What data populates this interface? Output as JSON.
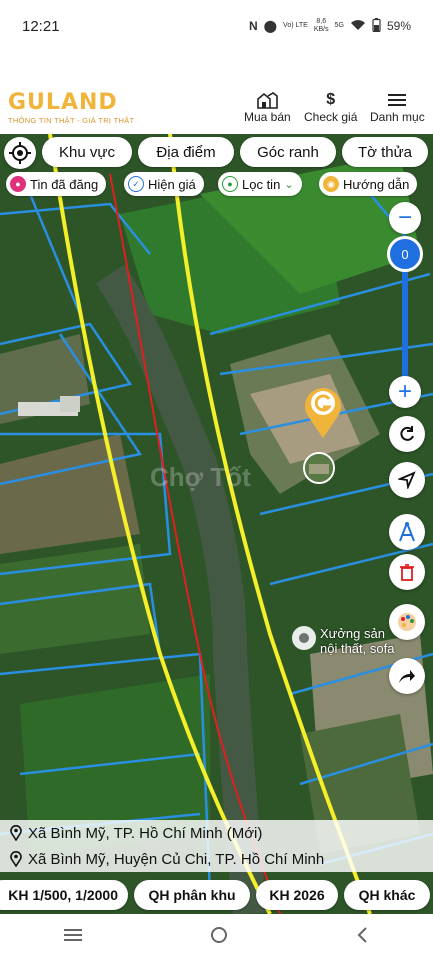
{
  "status_bar": {
    "time": "12:21",
    "net_label": "Vo) LTE",
    "speed_value": "8,6",
    "speed_unit": "KB/s",
    "network": "5G",
    "battery": "59%"
  },
  "brand": {
    "name": "GULAND",
    "tagline": "THÔNG TIN THẬT - GIÁ TRỊ THẬT",
    "color": "#f1b43a"
  },
  "nav": {
    "buy_sell": "Mua bán",
    "check_price": "Check giá",
    "menu": "Danh mục"
  },
  "filters": {
    "area": "Khu vực",
    "place": "Địa điểm",
    "corner": "Góc ranh",
    "parcel": "Tờ thửa"
  },
  "toggles": {
    "posted": "Tin đã đăng",
    "show_price": "Hiện giá",
    "filter": "Lọc tin",
    "guide": "Hướng dẫn"
  },
  "zoom": {
    "value": "0",
    "minus": "−",
    "plus": "+"
  },
  "poi": {
    "label_line1": "Xưởng sản",
    "label_line2": "nội thất, sofa"
  },
  "address": {
    "new": "Xã Bình Mỹ, TP. Hồ Chí Minh (Mới)",
    "old": "Xã Bình Mỹ, Huyện Củ Chi, TP. Hồ Chí Minh"
  },
  "layers": {
    "scale": "KH 1/500, 1/2000",
    "zoning": "QH phân khu",
    "plan": "KH 2026",
    "other": "QH khác"
  },
  "watermark": "Chợ Tốt",
  "colors": {
    "accent_blue": "#1f6fe0",
    "plot_lines": "#2a8fe0",
    "road_yellow": "#f5ef2a",
    "boundary_red": "#e02020"
  }
}
